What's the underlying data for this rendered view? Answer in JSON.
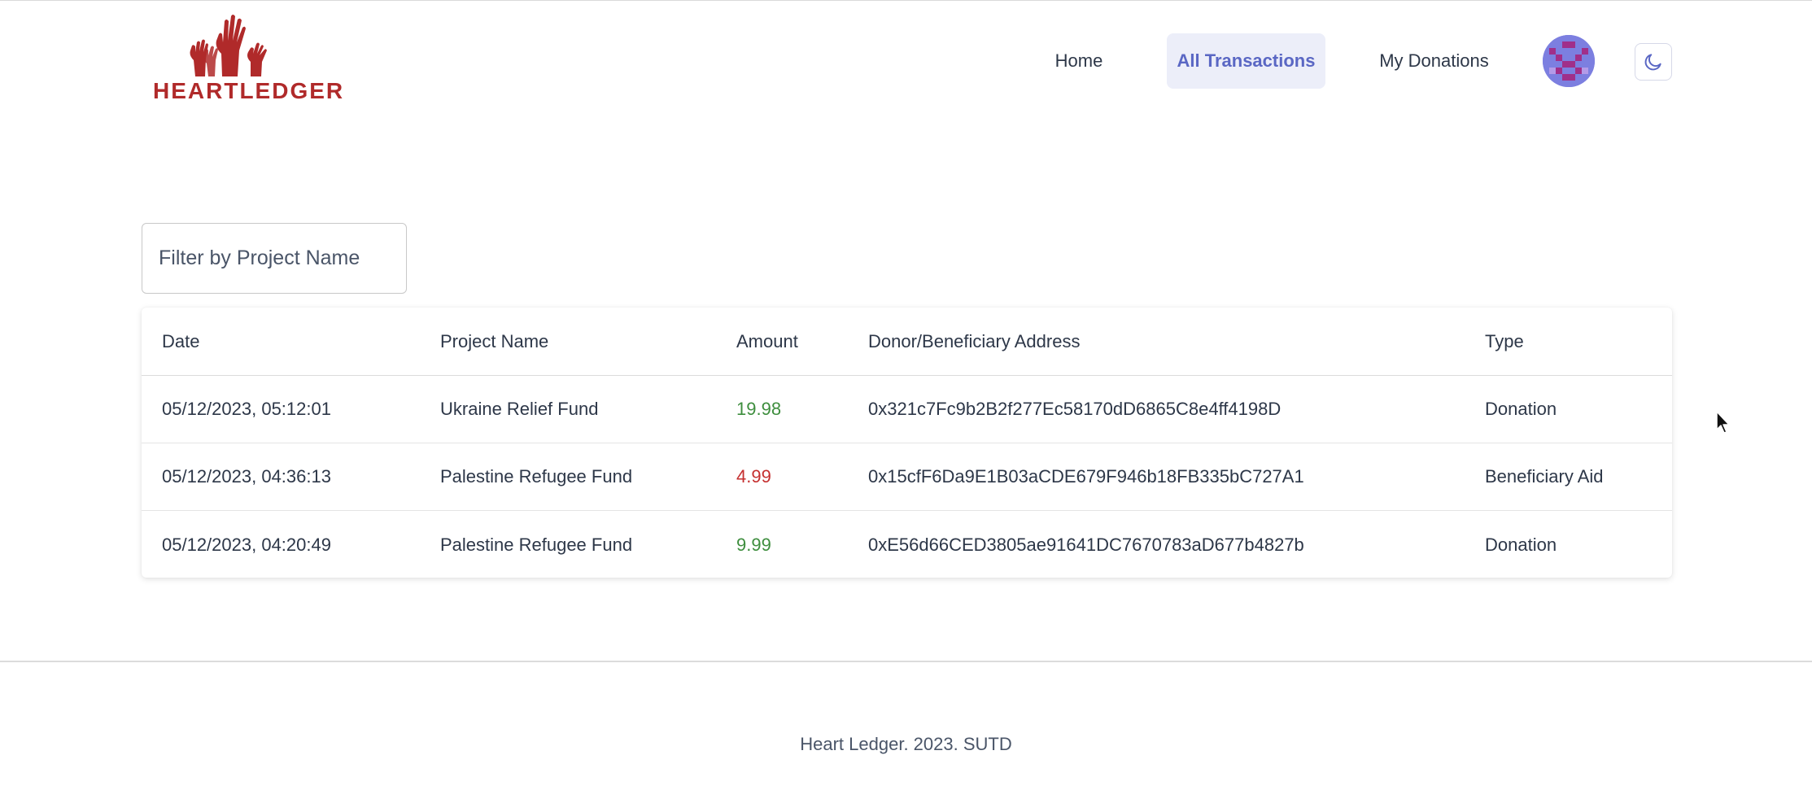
{
  "brand": {
    "name": "HEARTLEDGER",
    "color": "#b02a2a"
  },
  "nav": {
    "home": "Home",
    "all_transactions": "All Transactions",
    "my_donations": "My Donations",
    "active": "All Transactions"
  },
  "theme_toggle": {
    "icon": "moon-icon"
  },
  "filter": {
    "placeholder": "Filter by Project Name",
    "value": ""
  },
  "table": {
    "headers": [
      "Date",
      "Project Name",
      "Amount",
      "Donor/Beneficiary Address",
      "Type"
    ],
    "rows": [
      {
        "date": "05/12/2023, 05:12:01",
        "project": "Ukraine Relief Fund",
        "amount": "19.98",
        "amount_kind": "positive",
        "address": "0x321c7Fc9b2B2f277Ec58170dD6865C8e4ff4198D",
        "type": "Donation"
      },
      {
        "date": "05/12/2023, 04:36:13",
        "project": "Palestine Refugee Fund",
        "amount": "4.99",
        "amount_kind": "negative",
        "address": "0x15cfF6Da9E1B03aCDE679F946b18FB335bC727A1",
        "type": "Beneficiary Aid"
      },
      {
        "date": "05/12/2023, 04:20:49",
        "project": "Palestine Refugee Fund",
        "amount": "9.99",
        "amount_kind": "positive",
        "address": "0xE56d66CED3805ae91641DC7670783aD677b4827b",
        "type": "Donation"
      }
    ]
  },
  "footer": {
    "text": "Heart Ledger. 2023. SUTD"
  },
  "colors": {
    "accent": "#5a67c4",
    "accent_bg": "#eceef9",
    "positive": "#3e8e3e",
    "negative": "#c53030"
  }
}
